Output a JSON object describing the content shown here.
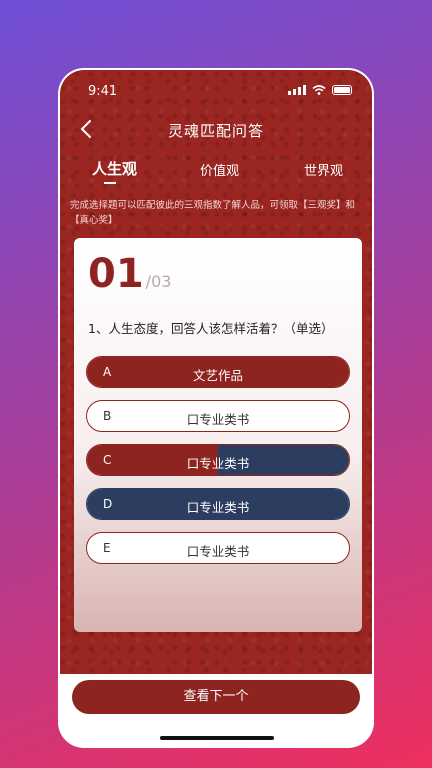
{
  "status_bar": {
    "time": "9:41"
  },
  "nav": {
    "title": "灵魂匹配问答",
    "back_icon": "chevron-left-icon"
  },
  "tabs": [
    {
      "label": "人生观",
      "active": true
    },
    {
      "label": "价值观",
      "active": false
    },
    {
      "label": "世界观",
      "active": false
    }
  ],
  "notice": "完成选择题可以匹配彼此的三观指数了解人品，可领取【三观奖】和【真心奖】",
  "question": {
    "number": "01",
    "total": "/03",
    "text": "1、人生态度，回答人该怎样活着？（单选）",
    "options": [
      {
        "letter": "A",
        "text": "文艺作品",
        "red_fill": 1.0,
        "navy_fill": 0.0
      },
      {
        "letter": "B",
        "text": "口专业类书",
        "red_fill": 0.0,
        "navy_fill": 0.0
      },
      {
        "letter": "C",
        "text": "口专业类书",
        "red_fill": 0.5,
        "navy_fill": 0.5
      },
      {
        "letter": "D",
        "text": "口专业类书",
        "red_fill": 0.0,
        "navy_fill": 1.0
      },
      {
        "letter": "E",
        "text": "口专业类书",
        "red_fill": 0.0,
        "navy_fill": 0.0
      }
    ]
  },
  "footer": {
    "next_label": "查看下一个"
  },
  "colors": {
    "primary": "#8e2420",
    "navy": "#2d3d5f",
    "background_start": "#6f4fd6",
    "background_end": "#ee2f5e"
  }
}
